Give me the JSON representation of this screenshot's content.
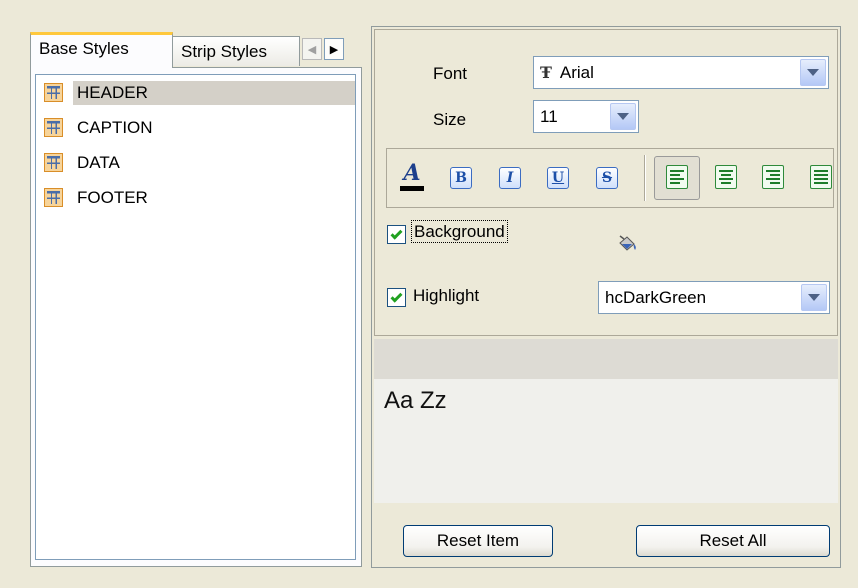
{
  "tabs": {
    "base_styles": "Base Styles",
    "strip_styles": "Strip Styles",
    "scroll_left": "◀",
    "scroll_right": "▶"
  },
  "styles_list": {
    "items": [
      {
        "label": "HEADER",
        "selected": true
      },
      {
        "label": "CAPTION",
        "selected": false
      },
      {
        "label": "DATA",
        "selected": false
      },
      {
        "label": "FOOTER",
        "selected": false
      }
    ]
  },
  "font": {
    "label": "Font",
    "value": "Arial",
    "icon": "truetype-font-icon"
  },
  "size": {
    "label": "Size",
    "value": "11"
  },
  "toolbar": {
    "font_color_glyph": "A",
    "bold_glyph": "B",
    "italic_glyph": "I",
    "underline_glyph": "U",
    "strike_glyph": "S",
    "font_color": "#000000",
    "alignment": "left"
  },
  "background": {
    "label": "Background",
    "checked": true,
    "icon": "paint-bucket-icon"
  },
  "highlight": {
    "label": "Highlight",
    "checked": true,
    "value": "hcDarkGreen"
  },
  "preview": {
    "text": "Aa Zz"
  },
  "buttons": {
    "reset_item": "Reset Item",
    "reset_all": "Reset All"
  },
  "colors": {
    "tab_accent": "#ffc83c",
    "selection": "#d4d0c8",
    "checkmark": "#21a121",
    "align_buttons": "#2e8a3a",
    "style_buttons": "#3b6cc2"
  }
}
